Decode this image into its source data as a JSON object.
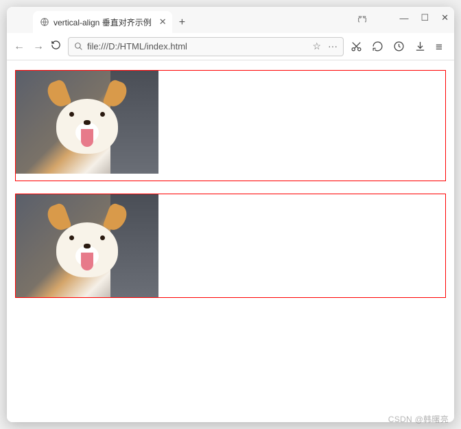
{
  "window": {
    "minimize": "—",
    "maximize": "☐",
    "close": "✕"
  },
  "tab": {
    "title": "vertical-align 垂直对齐示例",
    "close": "✕"
  },
  "newtab": "+",
  "nav": {
    "back": "←",
    "forward": "→"
  },
  "urlbar": {
    "search_glyph": "Q",
    "url": "file:///D:/HTML/index.html",
    "star": "☆",
    "more": "···"
  },
  "tools": {
    "cut": "cut",
    "undo": "↺",
    "clock": "clock",
    "download": "download",
    "menu": "≡"
  },
  "watermark": "CSDN @韩曙亮"
}
